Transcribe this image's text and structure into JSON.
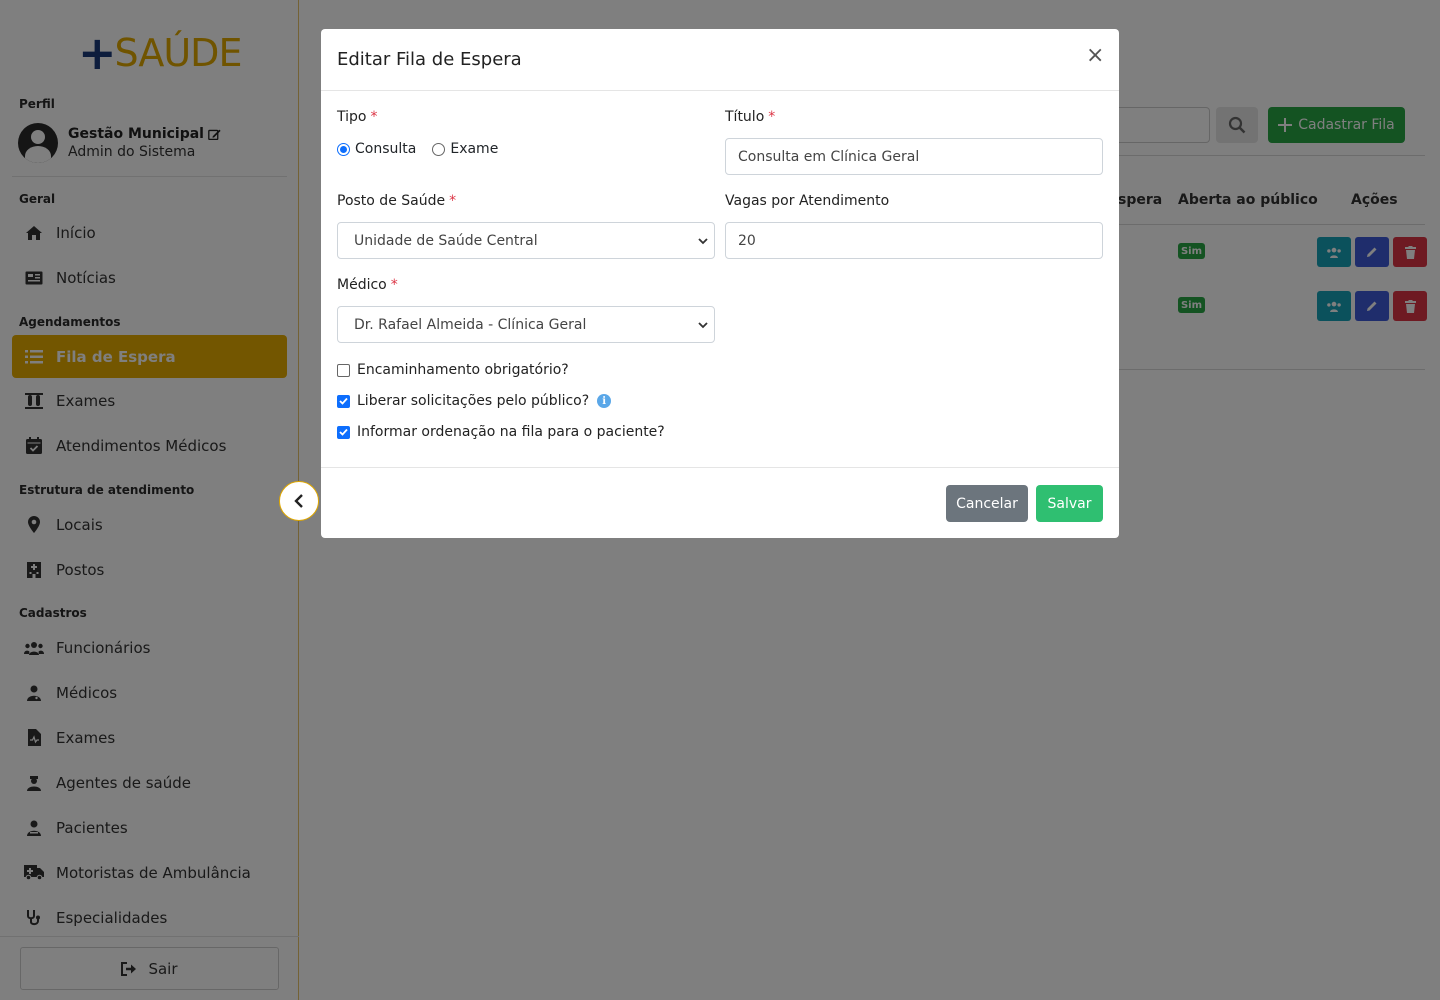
{
  "brand": {
    "plus": "+",
    "name": "SAÚDE"
  },
  "profile": {
    "section": "Perfil",
    "name": "Gestão Municipal",
    "role": "Admin do Sistema"
  },
  "sections": {
    "geral": "Geral",
    "agendamentos": "Agendamentos",
    "estrutura": "Estrutura de atendimento",
    "cadastros": "Cadastros"
  },
  "nav": {
    "inicio": "Início",
    "noticias": "Notícias",
    "fila": "Fila de Espera",
    "exames": "Exames",
    "atendimentos": "Atendimentos Médicos",
    "locais": "Locais",
    "postos": "Postos",
    "funcionarios": "Funcionários",
    "medicos": "Médicos",
    "exames_cad": "Exames",
    "agentes": "Agentes de saúde",
    "pacientes": "Pacientes",
    "motoristas": "Motoristas de Ambulância",
    "especialidades": "Especialidades"
  },
  "logout": "Sair",
  "background": {
    "add_button": "Cadastrar Fila",
    "table_headers": {
      "espera": "spera",
      "aberta": "Aberta ao público",
      "acoes": "Ações"
    },
    "badge": "Sim"
  },
  "modal": {
    "title": "Editar Fila de Espera",
    "close": "×",
    "tipo_label": "Tipo",
    "tipo_options": [
      "Consulta",
      "Exame"
    ],
    "titulo_label": "Título",
    "titulo_value": "Consulta em Clínica Geral",
    "posto_label": "Posto de Saúde",
    "posto_value": "Unidade de Saúde Central",
    "vagas_label": "Vagas por Atendimento",
    "vagas_value": "20",
    "medico_label": "Médico",
    "medico_value": "Dr. Rafael Almeida - Clínica Geral",
    "checkboxes": [
      "Encaminhamento obrigatório?",
      "Liberar solicitações pelo público?",
      "Informar ordenação na fila para o paciente?"
    ],
    "required_mark": "*",
    "info": "i",
    "cancel": "Cancelar",
    "save": "Salvar"
  }
}
